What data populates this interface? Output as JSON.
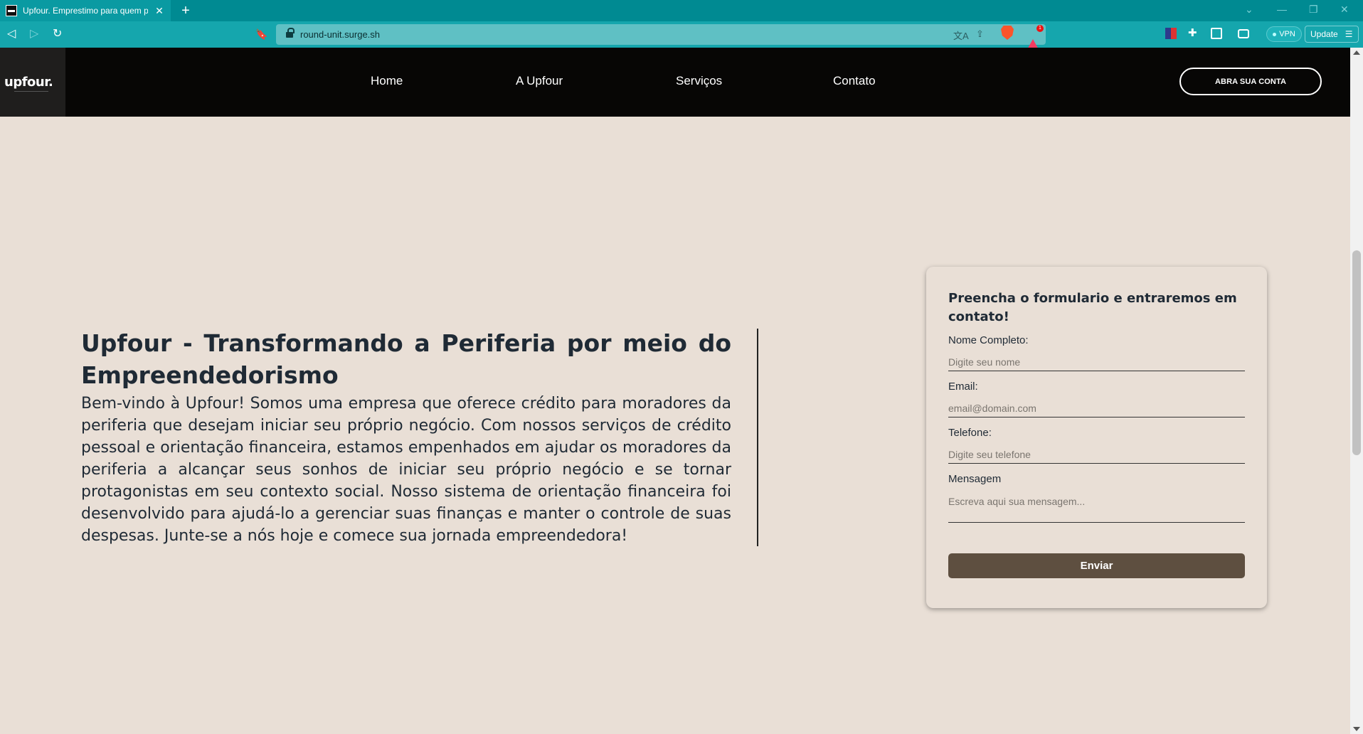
{
  "browser": {
    "tab_title": "Upfour. Emprestimo para quem p",
    "url": "round-unit.surge.sh",
    "vpn_label": "VPN",
    "update_label": "Update",
    "rewards_badge": "1"
  },
  "site": {
    "logo": "upfour.",
    "nav": {
      "home": "Home",
      "about": "A Upfour",
      "services": "Serviços",
      "contact": "Contato"
    },
    "cta_label": "ABRA SUA CONTA"
  },
  "hero": {
    "title": "Upfour - Transformando a Periferia por meio do Empreendedorismo",
    "text": "Bem-vindo à Upfour! Somos uma empresa que oferece crédito para moradores da periferia que desejam iniciar seu próprio negócio. Com nossos serviços de crédito pessoal e orientação financeira, estamos empenhados em ajudar os moradores da periferia a alcançar seus sonhos de iniciar seu próprio negócio e se tornar protagonistas em seu contexto social. Nosso sistema de orientação financeira foi desenvolvido para ajudá-lo a gerenciar suas finanças e manter o controle de suas despesas. Junte-se a nós hoje e comece sua jornada empreendedora!"
  },
  "form": {
    "title": "Preencha o formulario e entraremos em contato!",
    "name_label": "Nome Completo:",
    "name_placeholder": "Digite seu nome",
    "email_label": "Email:",
    "email_placeholder": "email@domain.com",
    "phone_label": "Telefone:",
    "phone_placeholder": "Digite seu telefone",
    "message_label": "Mensagem",
    "message_placeholder": "Escreva aqui sua mensagem...",
    "submit_label": "Enviar"
  }
}
